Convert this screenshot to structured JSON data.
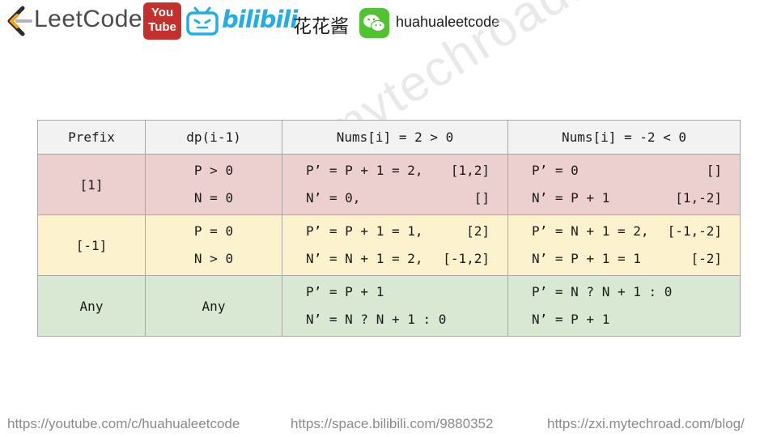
{
  "header": {
    "leetcode_text": "LeetCode",
    "youtube_top": "You",
    "youtube_bottom": "Tube",
    "bilibili_text": "bilibili",
    "cn_name": "花花酱",
    "handle": "huahualeetcode"
  },
  "watermark": "https://zxi.mytechroad.com/blog/",
  "table": {
    "headers": [
      "Prefix",
      "dp(i-1)",
      "Nums[i] = 2 > 0",
      "Nums[i] = -2 < 0"
    ],
    "rows": [
      {
        "prefix": "[1]",
        "dp_lines": [
          "P > 0",
          "N = 0"
        ],
        "pos_lines": [
          {
            "expr": "P’ = P + 1 = 2,",
            "arr": "[1,2]"
          },
          {
            "expr": "N’ = 0,",
            "arr": "[]"
          }
        ],
        "neg_lines": [
          {
            "expr": "P’ = 0",
            "arr": "[]"
          },
          {
            "expr": "N’ = P + 1",
            "arr": "[1,-2]"
          }
        ]
      },
      {
        "prefix": "[-1]",
        "dp_lines": [
          "P = 0",
          "N > 0"
        ],
        "pos_lines": [
          {
            "expr": "P’ = P + 1 = 1,",
            "arr": "[2]"
          },
          {
            "expr": "N’ = N + 1 = 2,",
            "arr": "[-1,2]"
          }
        ],
        "neg_lines": [
          {
            "expr": "P’ = N + 1 = 2,",
            "arr": "[-1,-2]"
          },
          {
            "expr": "N’ = P + 1 = 1",
            "arr": "[-2]"
          }
        ]
      },
      {
        "prefix": "Any",
        "dp": "Any",
        "pos_lines": [
          "P’ = P + 1",
          "N’ = N ? N + 1 : 0"
        ],
        "neg_lines": [
          "P’ = N ? N + 1 : 0",
          "N’ = P + 1"
        ]
      }
    ]
  },
  "footer": {
    "youtube_url": "https://youtube.com/c/huahualeetcode",
    "bilibili_url": "https://space.bilibili.com/9880352",
    "blog_url": "https://zxi.mytechroad.com/blog/"
  },
  "colors": {
    "row_positive_prefix": "#ecd0d0",
    "row_negative_prefix": "#fdf2ce",
    "row_any_prefix": "#d9e8d3",
    "header_row": "#f2f2f2",
    "border": "#a8a8a8",
    "youtube_red": "#c4302b",
    "bilibili_blue": "#23ade5",
    "wechat_green": "#51c332",
    "leetcode_orange": "#f89f1b"
  },
  "icons": [
    "leetcode-logo-icon",
    "youtube-logo-icon",
    "bilibili-tv-icon",
    "wechat-logo-icon"
  ]
}
